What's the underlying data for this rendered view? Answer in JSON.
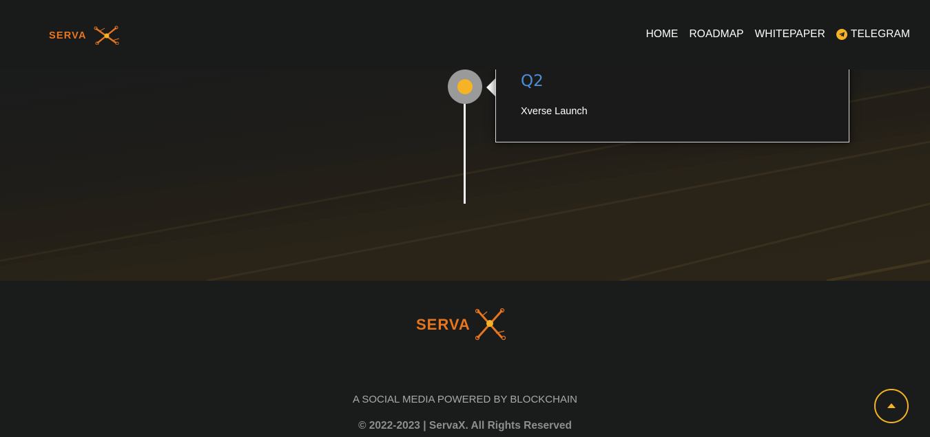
{
  "brand": {
    "logo_text": "SERVA",
    "logo_mark": "X",
    "colors": {
      "primary_orange": "#e8761e",
      "accent_yellow": "#f5b325",
      "title_blue": "#4c8fd6"
    }
  },
  "nav": {
    "items": [
      {
        "label": "HOME"
      },
      {
        "label": "ROADMAP"
      },
      {
        "label": "WHITEPAPER"
      },
      {
        "label": "TELEGRAM",
        "icon": "telegram-icon"
      }
    ]
  },
  "roadmap": {
    "milestone": {
      "title": "Q2",
      "description": "Xverse Launch"
    }
  },
  "footer": {
    "tagline": "A SOCIAL MEDIA POWERED BY BLOCKCHAIN",
    "copyright": "© 2022-2023 | ServaX. All Rights Reserved",
    "back_to_top_icon": "arrow-up-icon"
  }
}
